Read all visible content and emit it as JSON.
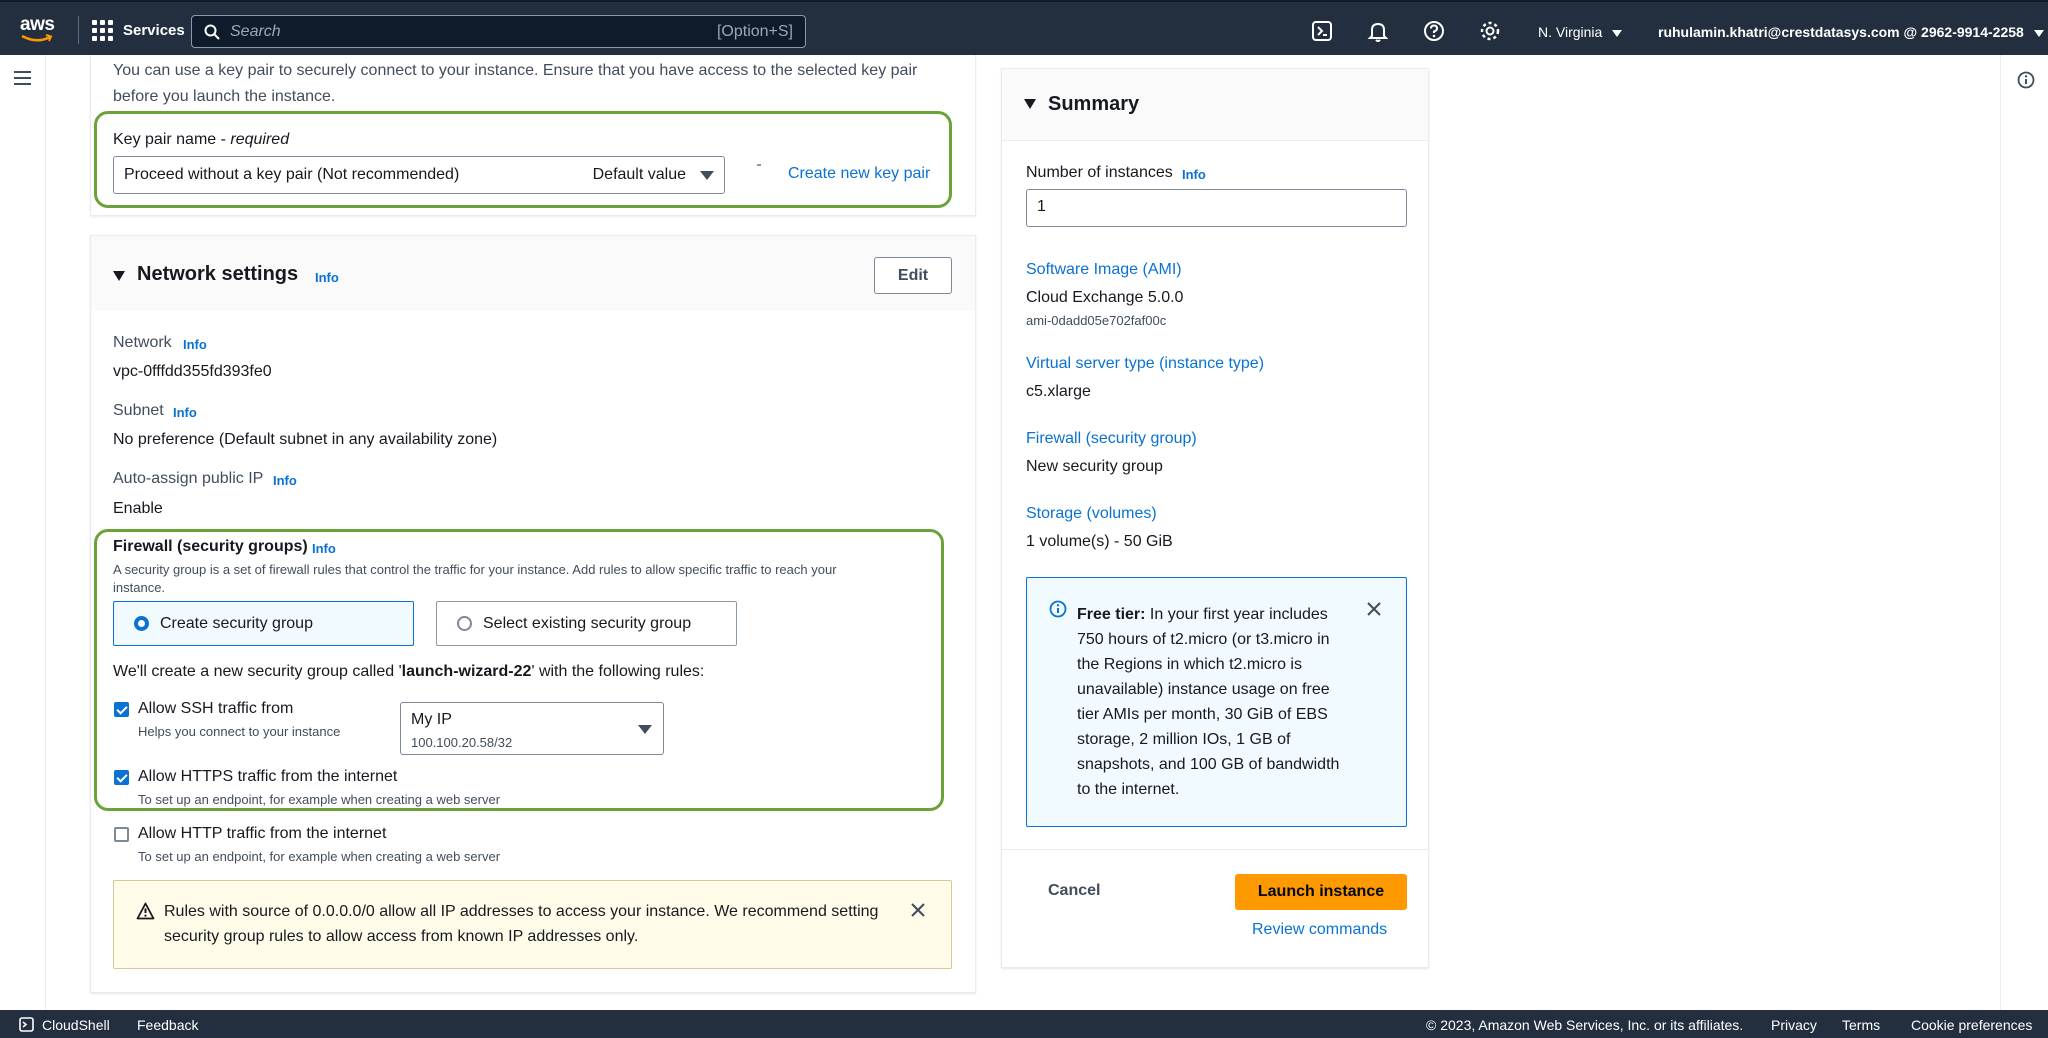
{
  "nav": {
    "logo": "aws",
    "services": "Services",
    "search_placeholder": "Search",
    "search_hotkey": "[Option+S]",
    "region": "N. Virginia",
    "account": "ruhulamin.khatri@crestdatasys.com @ 2962-9914-2258"
  },
  "keypair": {
    "intro_line1": "You can use a key pair to securely connect to your instance. Ensure that you have access to the selected key pair",
    "intro_line2": "before you launch the instance.",
    "label": "Key pair name - ",
    "label_required": "required",
    "selected": "Proceed without a key pair (Not recommended)",
    "default_tag": "Default value",
    "create_link": "Create new key pair"
  },
  "network": {
    "title": "Network settings",
    "info": "Info",
    "edit": "Edit",
    "network_label": "Network",
    "network_value": "vpc-0fffdd355fd393fe0",
    "subnet_label": "Subnet",
    "subnet_value": "No preference (Default subnet in any availability zone)",
    "public_ip_label": "Auto-assign public IP",
    "public_ip_value": "Enable",
    "firewall_label": "Firewall (security groups)",
    "firewall_desc_line1": "A security group is a set of firewall rules that control the traffic for your instance. Add rules to allow specific traffic to reach your",
    "firewall_desc_line2": "instance.",
    "option_create": "Create security group",
    "option_select": "Select existing security group",
    "create_msg_prefix": "We'll create a new security group called '",
    "create_msg_name": "launch-wizard-22",
    "create_msg_suffix": "' with the following rules:",
    "ssh_label": "Allow SSH traffic from",
    "ssh_desc": "Helps you connect to your instance",
    "ssh_source": "My IP",
    "ssh_source_ip": "100.100.20.58/32",
    "https_label": "Allow HTTPS traffic from the internet",
    "https_desc": "To set up an endpoint, for example when creating a web server",
    "http_label": "Allow HTTP traffic from the internet",
    "http_desc": "To set up an endpoint, for example when creating a web server",
    "warning_line1": "Rules with source of 0.0.0.0/0 allow all IP addresses to access your instance. We recommend setting",
    "warning_line2": "security group rules to allow access from known IP addresses only."
  },
  "summary": {
    "title": "Summary",
    "instances_label": "Number of instances",
    "instances_info": "Info",
    "instances_value": "1",
    "ami_label": "Software Image (AMI)",
    "ami_value": "Cloud Exchange 5.0.0",
    "ami_id": "ami-0dadd05e702faf00c",
    "type_label": "Virtual server type (instance type)",
    "type_value": "c5.xlarge",
    "firewall_label": "Firewall (security group)",
    "firewall_value": "New security group",
    "storage_label": "Storage (volumes)",
    "storage_value": "1 volume(s) - 50 GiB",
    "freetier_bold": "Free tier:",
    "freetier_lines": [
      " In your first year includes",
      "750 hours of t2.micro (or t3.micro in",
      "the Regions in which t2.micro is",
      "unavailable) instance usage on free",
      "tier AMIs per month, 30 GiB of EBS",
      "storage, 2 million IOs, 1 GB of",
      "snapshots, and 100 GB of bandwidth",
      "to the internet."
    ],
    "cancel": "Cancel",
    "launch": "Launch instance",
    "review": "Review commands"
  },
  "footer": {
    "cloudshell": "CloudShell",
    "feedback": "Feedback",
    "copyright": "© 2023, Amazon Web Services, Inc. or its affiliates.",
    "privacy": "Privacy",
    "terms": "Terms",
    "cookies": "Cookie preferences"
  },
  "colors": {
    "nav_bg": "#232f3e",
    "accent_blue": "#0972d3",
    "highlight_green": "#6ba33a",
    "launch_orange": "#ff9900",
    "warning_bg": "#fffce9"
  }
}
